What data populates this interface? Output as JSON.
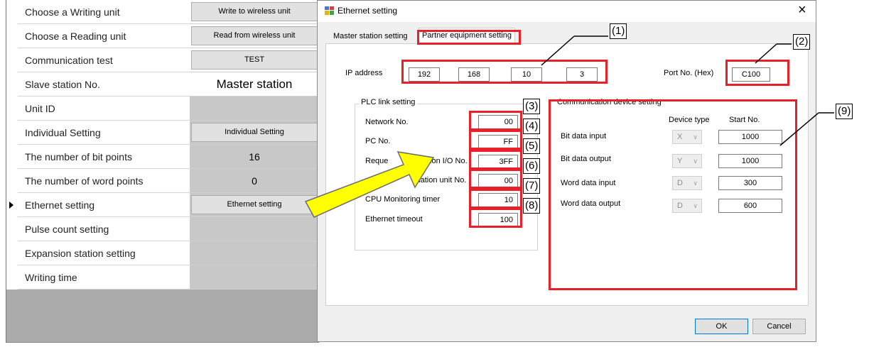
{
  "left_grid": {
    "rows": [
      {
        "label": "Choose a Writing unit",
        "value": "Write to wireless unit",
        "value_kind": "button"
      },
      {
        "label": "Choose a Reading unit",
        "value": "Read from wireless unit",
        "value_kind": "button"
      },
      {
        "label": "Communication test",
        "value": "TEST",
        "value_kind": "button"
      },
      {
        "label": "Slave station No.",
        "value": "Master station",
        "value_kind": "text-large"
      },
      {
        "label": "Unit ID",
        "value": "",
        "value_kind": "empty"
      },
      {
        "label": "Individual Setting",
        "value": "Individual Setting",
        "value_kind": "button"
      },
      {
        "label": "The number of bit points",
        "value": "16",
        "value_kind": "text"
      },
      {
        "label": "The number of word points",
        "value": "0",
        "value_kind": "text"
      },
      {
        "label": "Ethernet setting",
        "value": "Ethernet setting",
        "value_kind": "button",
        "current": true
      },
      {
        "label": "Pulse count setting",
        "value": "",
        "value_kind": "empty"
      },
      {
        "label": "Expansion station setting",
        "value": "",
        "value_kind": "empty"
      },
      {
        "label": "Writing time",
        "value": "",
        "value_kind": "empty"
      }
    ]
  },
  "dialog": {
    "title": "Ethernet setting",
    "close_icon": "close-icon",
    "tabs": [
      {
        "label": "Master station setting"
      },
      {
        "label": "Partner equipment setting",
        "active": true
      }
    ],
    "ip_label": "IP address",
    "ip_octets": [
      "192",
      "168",
      "10",
      "3"
    ],
    "port_label": "Port No. (Hex)",
    "port_value": "C100",
    "plc": {
      "title": "PLC link setting",
      "network_label": "Network No.",
      "network_value": "00",
      "pc_label": "PC No.",
      "pc_value": "FF",
      "request_label_a": "Reque",
      "request_label_b": "tion I/O No.",
      "request_value": "3FF",
      "dest_label": "tination unit No.",
      "dest_value": "00",
      "cpu_label": "CPU Monitoring timer",
      "cpu_value": "10",
      "eth_timeout_label": "Ethernet timeout",
      "eth_timeout_value": "100"
    },
    "comm": {
      "title": "Communication device setting",
      "device_type_header": "Device type",
      "start_no_header": "Start No.",
      "rows": [
        {
          "label": "Bit data input",
          "device": "X",
          "start": "1000"
        },
        {
          "label": "Bit data output",
          "device": "Y",
          "start": "1000"
        },
        {
          "label": "Word data input",
          "device": "D",
          "start": "300"
        },
        {
          "label": "Word data output",
          "device": "D",
          "start": "600"
        }
      ]
    },
    "ok_label": "OK",
    "cancel_label": "Cancel"
  },
  "callouts": {
    "n1": "(1)",
    "n2": "(2)",
    "n3": "(3)",
    "n4": "(4)",
    "n5": "(5)",
    "n6": "(6)",
    "n7": "(7)",
    "n8": "(8)",
    "n9": "(9)",
    "highlight_color": "#e8202a",
    "arrow_fill": "#ffff00"
  }
}
